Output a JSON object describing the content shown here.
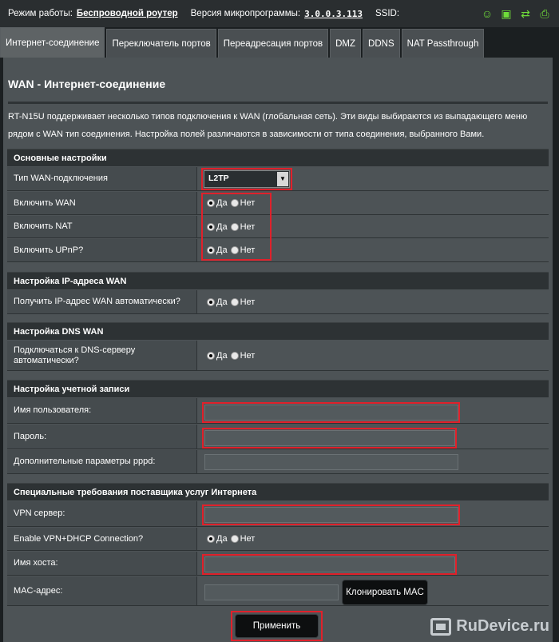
{
  "topbar": {
    "mode_label": "Режим работы:",
    "mode_value": "Беспроводной роутер",
    "fw_label": "Версия микропрограммы:",
    "fw_value": "3.0.0.3.113",
    "ssid_label": "SSID:"
  },
  "tabs": [
    "Интернет-соединение",
    "Переключатель портов",
    "Переадресация портов",
    "DMZ",
    "DDNS",
    "NAT Passthrough"
  ],
  "page": {
    "title": "WAN - Интернет-соединение",
    "description": "RT-N15U поддерживает несколько типов подключения к WAN (глобальная сеть). Эти виды выбираются из выпадающего меню рядом с WAN тип соединения. Настройка полей различаются в зависимости от типа соединения, выбранного Вами."
  },
  "radio": {
    "yes": "Да",
    "no": "Нет"
  },
  "basic": {
    "header": "Основные настройки",
    "wan_type_label": "Тип WAN-подключения",
    "wan_type_value": "L2TP",
    "enable_wan": "Включить WAN",
    "enable_nat": "Включить NAT",
    "enable_upnp": "Включить UPnP?"
  },
  "ip": {
    "header": "Настройка IP-адреса WAN",
    "auto_ip": "Получить IP-адрес WAN автоматически?"
  },
  "dns": {
    "header": "Настройка DNS WAN",
    "auto_dns": "Подключаться к DNS-серверу автоматически?"
  },
  "account": {
    "header": "Настройка учетной записи",
    "username": "Имя пользователя:",
    "password": "Пароль:",
    "pppd": "Дополнительные параметры pppd:"
  },
  "isp": {
    "header": "Специальные требования поставщика услуг Интернета",
    "vpn_server": "VPN сервер:",
    "vpn_dhcp": "Enable VPN+DHCP Connection?",
    "hostname": "Имя хоста:",
    "mac": "MAC-адрес:",
    "clone_mac": "Клонировать MAC"
  },
  "apply": "Применить",
  "watermark": "RuDevice.ru",
  "colors": {
    "highlight": "#e0212b",
    "status_icons": "#6fdc3a"
  }
}
